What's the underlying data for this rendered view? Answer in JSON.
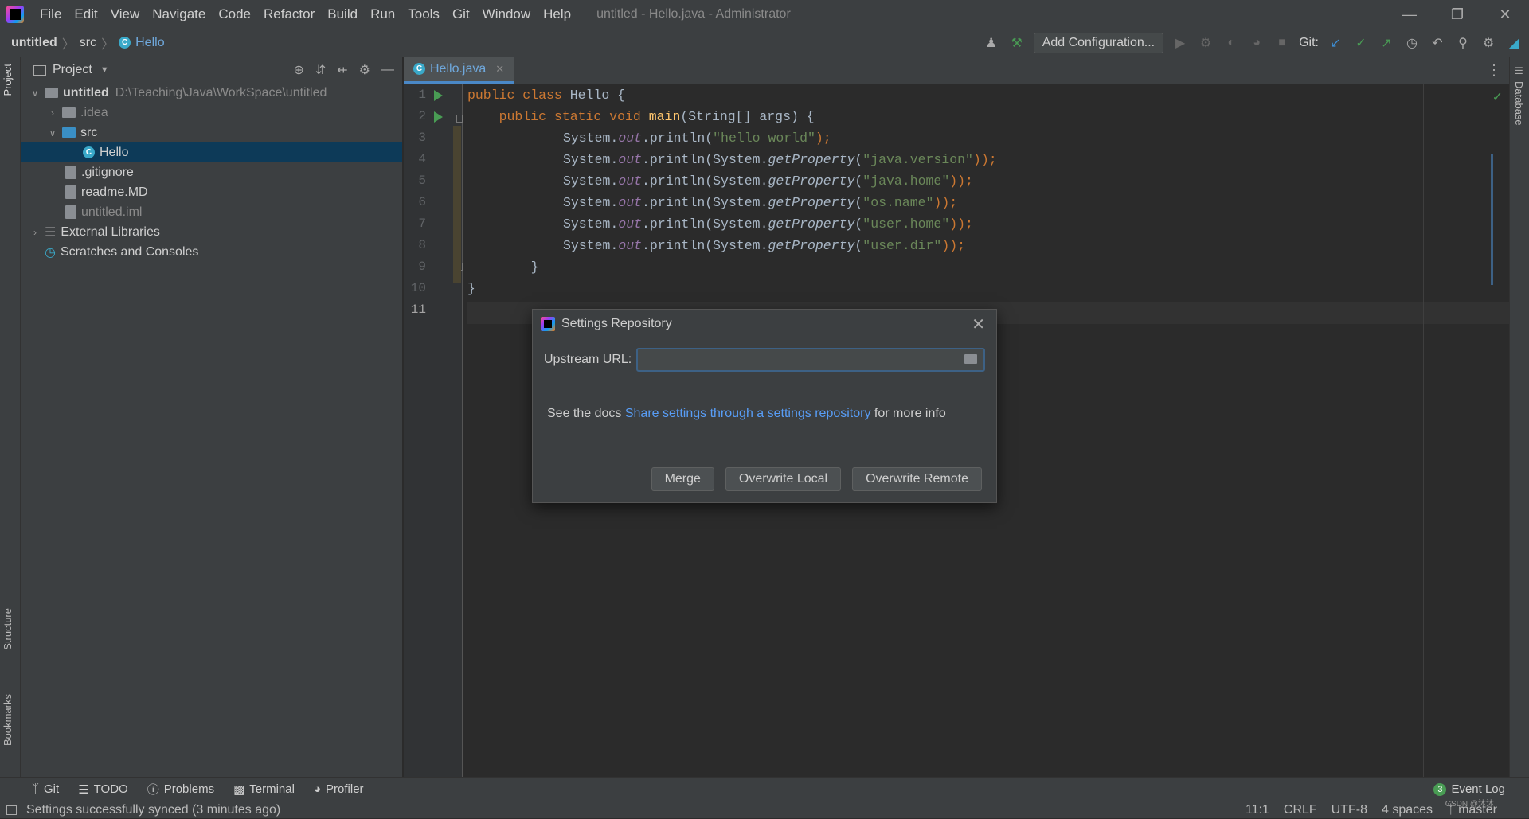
{
  "titlebar": {
    "menu": [
      "File",
      "Edit",
      "View",
      "Navigate",
      "Code",
      "Refactor",
      "Build",
      "Run",
      "Tools",
      "Git",
      "Window",
      "Help"
    ],
    "window_title": "untitled - Hello.java - Administrator"
  },
  "navbar": {
    "project": "untitled",
    "folder": "src",
    "file": "Hello",
    "add_configuration": "Add Configuration...",
    "git_label": "Git:"
  },
  "left_tabs": {
    "project": "Project",
    "structure": "Structure",
    "bookmarks": "Bookmarks"
  },
  "project": {
    "title": "Project",
    "root": {
      "name": "untitled",
      "path": "D:\\Teaching\\Java\\WorkSpace\\untitled"
    },
    "items": {
      "idea": ".idea",
      "src": "src",
      "hello": "Hello",
      "gitignore": ".gitignore",
      "readme": "readme.MD",
      "iml": "untitled.iml",
      "external": "External Libraries",
      "scratches": "Scratches and Consoles"
    }
  },
  "editor": {
    "tab": "Hello.java",
    "line_numbers": [
      "1",
      "2",
      "3",
      "4",
      "5",
      "6",
      "7",
      "8",
      "9",
      "10",
      "11"
    ],
    "code": {
      "l1a": "public class ",
      "l1b": "Hello {",
      "l2a": "    public static void ",
      "l2b": "main",
      "l2c": "(String[] args) {",
      "sys": "System.",
      "out": "out",
      ".println": ".println(",
      "hello_str": "\"hello world\"",
      "end": ");",
      "sysgp": "System.",
      "gp": "getProperty",
      "p1": "\"java.version\"",
      "p2": "\"java.home\"",
      "p3": "\"os.name\"",
      "p4": "\"user.home\"",
      "p5": "\"user.dir\"",
      "end2": "));",
      "l9": "    }",
      "l10": "}"
    }
  },
  "right_tabs": {
    "database": "Database"
  },
  "dialog": {
    "title": "Settings Repository",
    "url_label": "Upstream URL:",
    "url_value": "",
    "docs_prefix": "See the docs ",
    "docs_link": "Share settings through a settings repository",
    "docs_suffix": " for more info",
    "buttons": {
      "merge": "Merge",
      "overwrite_local": "Overwrite Local",
      "overwrite_remote": "Overwrite Remote"
    }
  },
  "bottom": {
    "git": "Git",
    "todo": "TODO",
    "problems": "Problems",
    "terminal": "Terminal",
    "profiler": "Profiler",
    "event_count": "3",
    "event_log": "Event Log"
  },
  "status": {
    "message": "Settings successfully synced (3 minutes ago)",
    "position": "11:1",
    "line_sep": "CRLF",
    "encoding": "UTF-8",
    "indent": "4 spaces",
    "branch": "master",
    "watermark": "CSDN @沐沐"
  },
  "colors": {
    "bg": "#2b2b2b",
    "panel": "#3c3f41",
    "keyword": "#cc7832",
    "string": "#6a8759",
    "field": "#9876aa",
    "link": "#589df6",
    "selection": "#0d3a58"
  }
}
